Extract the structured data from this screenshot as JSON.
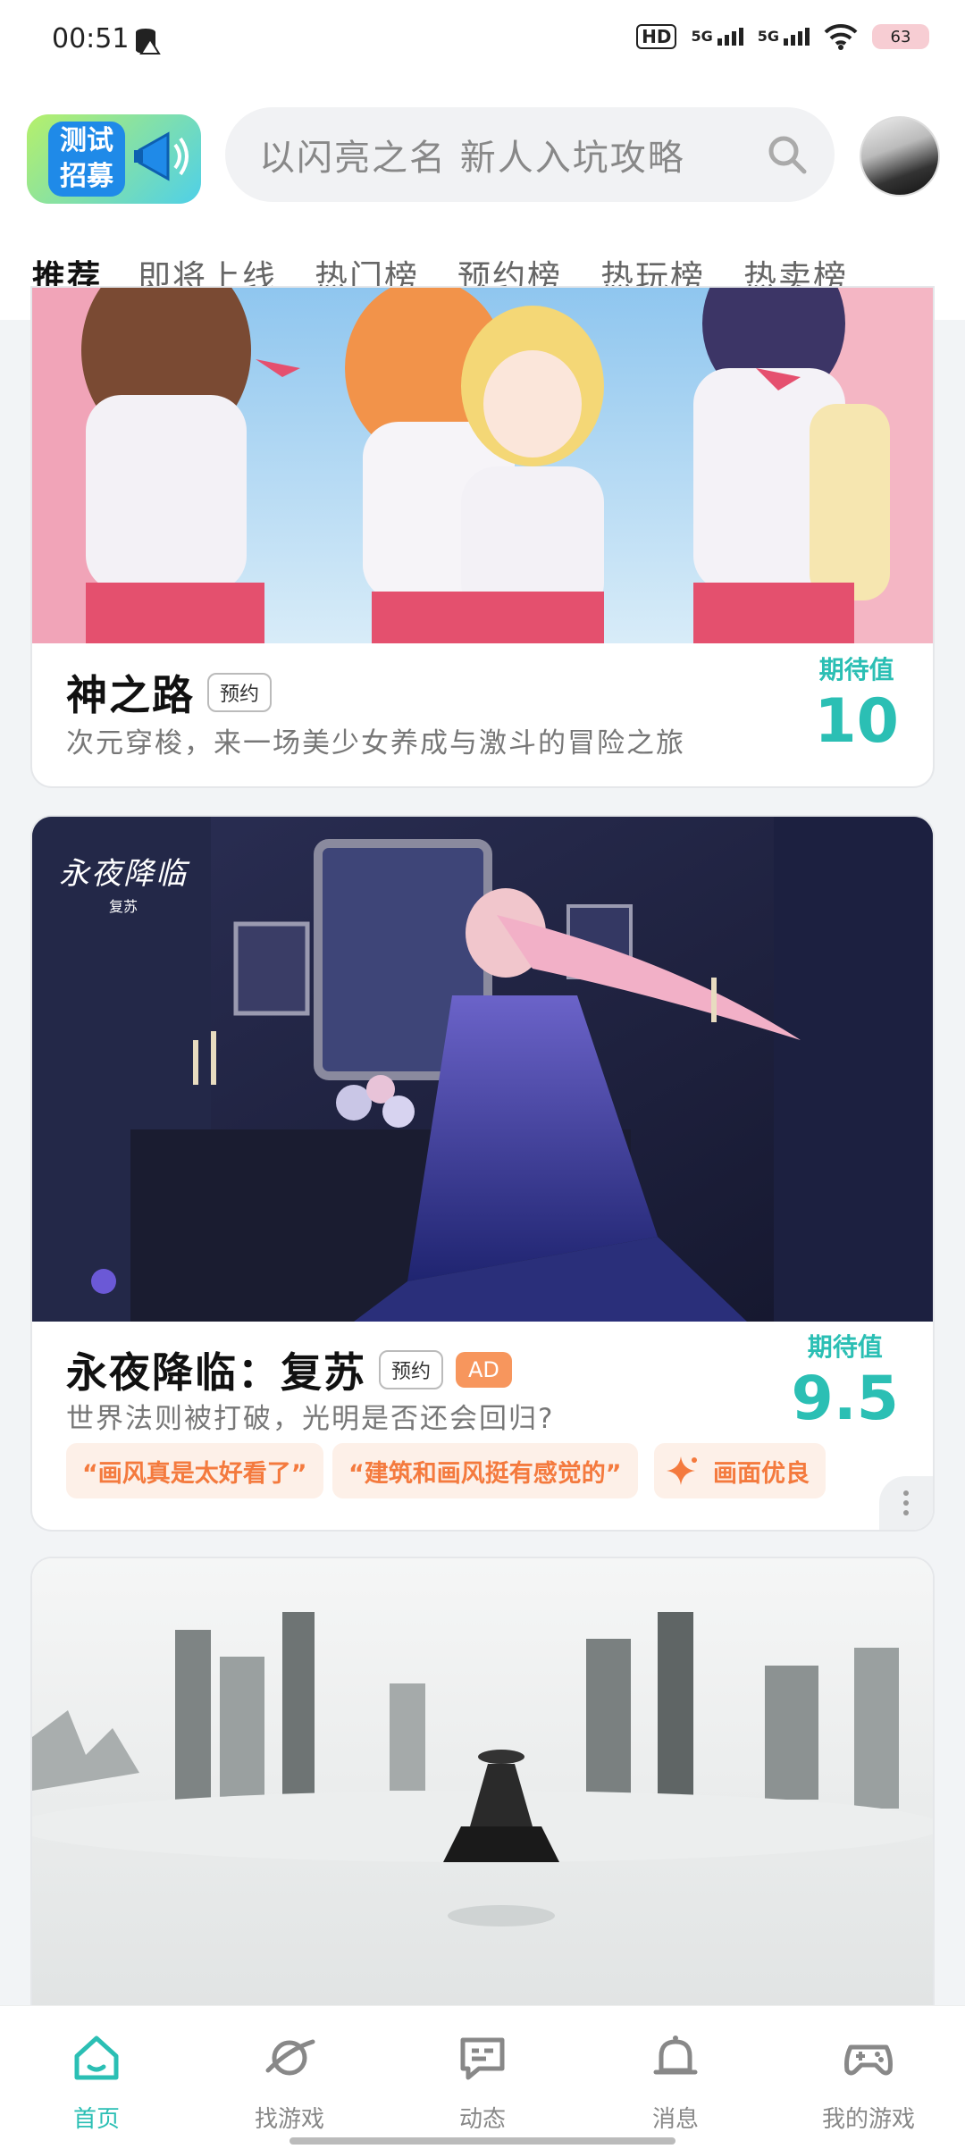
{
  "status_bar": {
    "time": "00:51",
    "hd": "HD",
    "signal1": "5G",
    "signal2": "5G",
    "battery": "63"
  },
  "header": {
    "promo_line1": "测试",
    "promo_line2": "招募",
    "search_placeholder": "以闪亮之名 新人入坑攻略"
  },
  "tabs": [
    "推荐",
    "即将上线",
    "热门榜",
    "预约榜",
    "热玩榜",
    "热卖榜"
  ],
  "cards": [
    {
      "title": "神之路",
      "tag": "预约",
      "desc": "次元穿梭，来一场美少女养成与激斗的冒险之旅",
      "expect_label": "期待值",
      "expect_value": "10"
    },
    {
      "title": "永夜降临：复苏",
      "tag": "预约",
      "ad": "AD",
      "logo_text": "永夜降临",
      "logo_sub": "复苏",
      "desc": "世界法则被打破，光明是否还会回归?",
      "expect_label": "期待值",
      "expect_value": "9.5",
      "chips": [
        "“画风真是太好看了”",
        "“建筑和画风挺有感觉的”",
        "画面优良"
      ]
    }
  ],
  "bottom_nav": [
    {
      "label": "首页",
      "icon": "home-icon"
    },
    {
      "label": "找游戏",
      "icon": "planet-icon"
    },
    {
      "label": "动态",
      "icon": "chat-icon"
    },
    {
      "label": "消息",
      "icon": "bell-icon"
    },
    {
      "label": "我的游戏",
      "icon": "gamepad-icon"
    }
  ],
  "colors": {
    "accent": "#2bbfb4",
    "ad": "#f7965d",
    "chip_text": "#f47a3e"
  }
}
